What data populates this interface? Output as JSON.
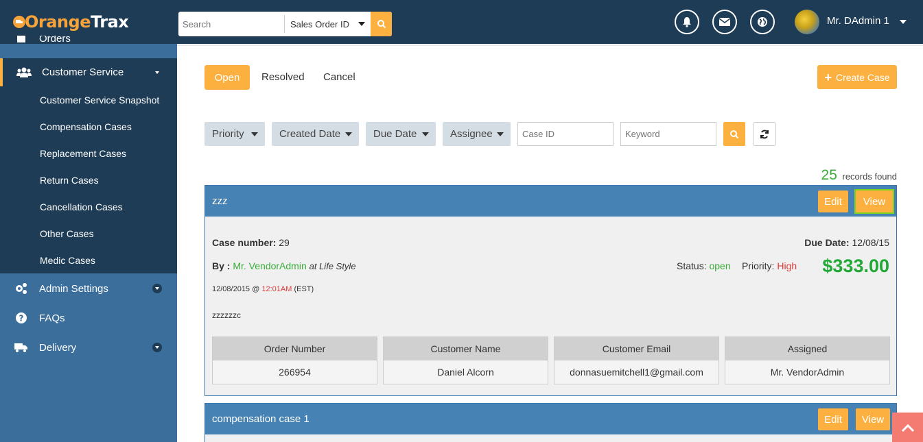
{
  "brand": {
    "logo_part1": "Orange",
    "logo_part2": "Trax"
  },
  "search": {
    "placeholder": "Search",
    "select_value": "Sales Order ID"
  },
  "user": {
    "name": "Mr. DAdmin 1"
  },
  "sidebar": {
    "partial_item": "Orders",
    "active_item": "Customer Service",
    "submenu": [
      "Customer Service Snapshot",
      "Compensation Cases",
      "Replacement Cases",
      "Return Cases",
      "Cancellation Cases",
      "Other Cases",
      "Medic Cases"
    ],
    "items": [
      "Admin Settings",
      "FAQs",
      "Delivery"
    ]
  },
  "tabs": {
    "open": "Open",
    "resolved": "Resolved",
    "cancel": "Cancel"
  },
  "create_case_label": "Create Case",
  "filters": {
    "priority": "Priority",
    "created_date": "Created Date",
    "due_date": "Due Date",
    "assignee": "Assignee",
    "case_id_placeholder": "Case ID",
    "keyword_placeholder": "Keyword"
  },
  "records": {
    "count": "25",
    "label": "records found"
  },
  "cases": [
    {
      "title": "zzz",
      "edit_label": "Edit",
      "view_label": "View",
      "case_number_label": "Case number:",
      "case_number": "29",
      "due_date_label": "Due Date:",
      "due_date": "12/08/15",
      "by_label": "By :",
      "by_name": "Mr. VendorAdmin",
      "by_store": "at Life Style",
      "status_label": "Status:",
      "status": "open",
      "priority_label": "Priority:",
      "priority": "High",
      "amount": "$333.00",
      "date": "12/08/2015 @",
      "time": "12:01AM",
      "tz": "(EST)",
      "description": "zzzzzzc",
      "headers": [
        "Order Number",
        "Customer Name",
        "Customer Email",
        "Assigned"
      ],
      "values": [
        "266954",
        "Daniel Alcorn",
        "donnasuemitchell1@gmail.com",
        "Mr. VendorAdmin"
      ]
    },
    {
      "title": "compensation case 1",
      "edit_label": "Edit",
      "view_label": "View"
    }
  ]
}
